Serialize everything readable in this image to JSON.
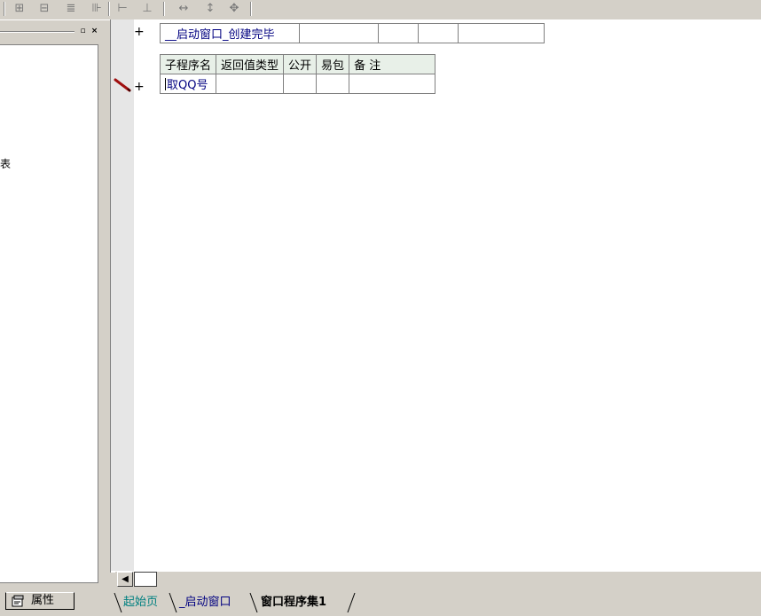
{
  "toolbar": {
    "icons": [
      "align-left-icon",
      "align-center-icon",
      "align-top-icon",
      "align-middle-icon",
      "space-horizontal-icon",
      "space-vertical-icon",
      "same-width-icon",
      "same-height-icon",
      "same-size-icon"
    ]
  },
  "left_panel": {
    "fragment_text": "表",
    "property_tab_label": "属性"
  },
  "editor": {
    "event_row": {
      "name": "__启动窗口_创建完毕"
    },
    "sub_table": {
      "headers": [
        "子程序名",
        "返回值类型",
        "公开",
        "易包",
        "备 注"
      ],
      "row": {
        "name": "取QQ号",
        "return_type": "",
        "public": "",
        "easy_pkg": "",
        "remark": ""
      }
    },
    "plus_symbol": "+"
  },
  "doc_tabs": [
    {
      "label": "起始页",
      "color": "#008080"
    },
    {
      "label": "_启动窗口",
      "color": "#000080"
    },
    {
      "label": "窗口程序集1",
      "color": "#000000",
      "active": true
    }
  ]
}
